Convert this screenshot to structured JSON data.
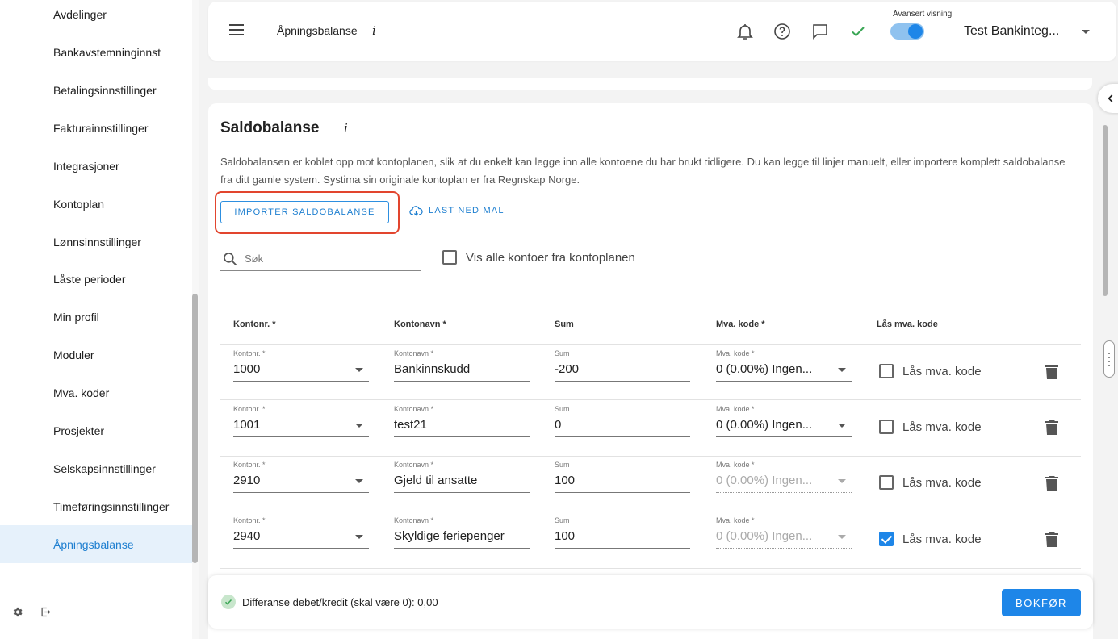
{
  "sidebar": {
    "items": [
      {
        "label": "Avdelinger"
      },
      {
        "label": "Bankavstemninginnst"
      },
      {
        "label": "Betalingsinnstillinger"
      },
      {
        "label": "Fakturainnstillinger"
      },
      {
        "label": "Integrasjoner"
      },
      {
        "label": "Kontoplan"
      },
      {
        "label": "Lønnsinnstillinger"
      },
      {
        "label": "Låste perioder"
      },
      {
        "label": "Min profil"
      },
      {
        "label": "Moduler"
      },
      {
        "label": "Mva. koder"
      },
      {
        "label": "Prosjekter"
      },
      {
        "label": "Selskapsinnstillinger"
      },
      {
        "label": "Timeføringsinnstillinger"
      },
      {
        "label": "Åpningsbalanse"
      }
    ],
    "active_item": "Åpningsbalanse"
  },
  "header": {
    "page_title": "Åpningsbalanse",
    "info_glyph": "i",
    "toggle_label": "Avansert visning",
    "toggle_on": true,
    "user_name": "Test Banki­nteg...",
    "icons": [
      "menu-icon",
      "bell-icon",
      "help-icon",
      "chat-icon",
      "check-icon",
      "chevron-down-icon"
    ]
  },
  "card": {
    "title": "Saldobalanse",
    "info_glyph": "i",
    "description": "Saldobalansen er koblet opp mot kontoplanen, slik at du enkelt kan legge inn alle kontoene du har brukt tidligere. Du kan legge til linjer manuelt, eller importere komplett saldobalanse fra ditt gamle system. Systima sin originale kontoplan er fra Regnskap Norge.",
    "import_button": "IMPORTER SALDOBALANSE",
    "download_button": "LAST NED MAL",
    "search_placeholder": "Søk",
    "show_all_label": "Vis alle kontoer fra kontoplanen",
    "show_all_checked": false
  },
  "table": {
    "headers": {
      "account_no": "Kontonr. *",
      "account_name": "Kontonavn *",
      "sum": "Sum",
      "vat_code": "Mva. kode *",
      "lock_vat": "Lås mva. kode"
    },
    "field_labels": {
      "account_no": "Kontonr. *",
      "account_name": "Kontonavn *",
      "sum": "Sum",
      "vat_code": "Mva. kode *"
    },
    "lock_label": "Lås mva. kode",
    "rows": [
      {
        "account_no": "1000",
        "account_name": "Bankinnskudd",
        "sum": "-200",
        "vat_code": "0 (0.00%) Ingen...",
        "vat_disabled": false,
        "locked": false
      },
      {
        "account_no": "1001",
        "account_name": "test21",
        "sum": "0",
        "vat_code": "0 (0.00%) Ingen...",
        "vat_disabled": false,
        "locked": false
      },
      {
        "account_no": "2910",
        "account_name": "Gjeld til ansatte",
        "sum": "100",
        "vat_code": "0 (0.00%) Ingen...",
        "vat_disabled": true,
        "locked": false
      },
      {
        "account_no": "2940",
        "account_name": "Skyldige feriepenger",
        "sum": "100",
        "vat_code": "0 (0.00%) Ingen...",
        "vat_disabled": true,
        "locked": true
      }
    ]
  },
  "footer": {
    "difference_text": "Differanse debet/kredit (skal være 0): 0,00",
    "status": "ok",
    "submit_button": "BOKFØR"
  },
  "colors": {
    "accent": "#1e86e8",
    "highlight": "#e2452e",
    "active_bg": "#e6f1fb",
    "success": "#3aa655"
  }
}
